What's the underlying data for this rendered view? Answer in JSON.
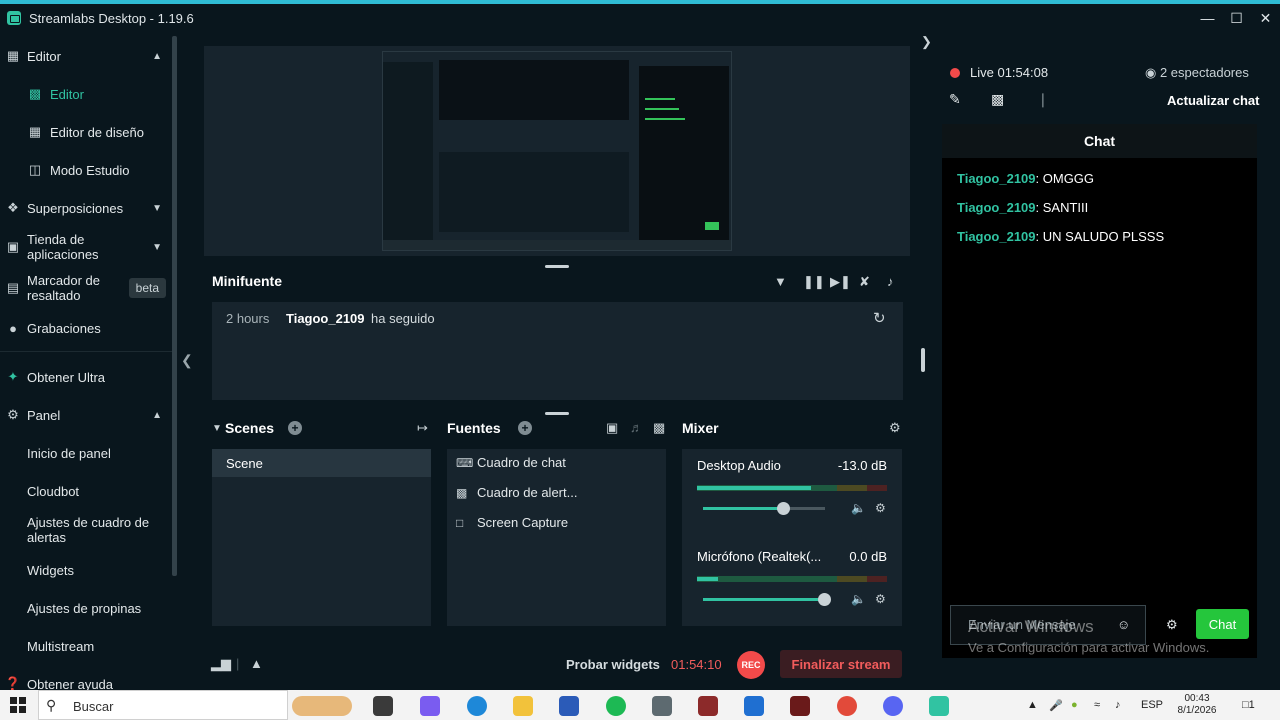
{
  "window": {
    "title": "Streamlabs Desktop - 1.19.6"
  },
  "sidebar": {
    "editor_group": "Editor",
    "editor": "Editor",
    "layout_editor": "Editor de diseño",
    "studio_mode": "Modo Estudio",
    "overlays": "Superposiciones",
    "app_store": "Tienda de aplicaciones",
    "highlighter": "Marcador de resaltado",
    "beta": "beta",
    "recordings": "Grabaciones",
    "ultra": "Obtener Ultra",
    "panel": "Panel",
    "dashboard_home": "Inicio de panel",
    "cloudbot": "Cloudbot",
    "alert_box_settings": "Ajustes de cuadro de alertas",
    "widgets": "Widgets",
    "tip_settings": "Ajustes de propinas",
    "multistream": "Multistream",
    "help": "Obtener ayuda"
  },
  "minifeed": {
    "title": "Minifuente",
    "events": [
      {
        "time": "2 hours",
        "user": "Tiagoo_2109",
        "action": "ha seguido"
      }
    ]
  },
  "scenes": {
    "title": "Scenes",
    "items": [
      "Scene"
    ]
  },
  "sources": {
    "title": "Fuentes",
    "items": [
      "Cuadro de chat",
      "Cuadro de alert...",
      "Screen Capture"
    ]
  },
  "mixer": {
    "title": "Mixer",
    "channels": [
      {
        "name": "Desktop Audio",
        "db": "-13.0 dB",
        "volume": 0.66,
        "level": 0.6
      },
      {
        "name": "Micrófono (Realtek(...",
        "db": "0.0 dB",
        "volume": 1.0,
        "level": 0.11
      }
    ]
  },
  "footer": {
    "test_widgets": "Probar widgets",
    "timer": "01:54:10",
    "rec": "REC",
    "end_stream": "Finalizar stream"
  },
  "live": {
    "status": "Live",
    "time": "01:54:08",
    "viewers": "2 espectadores",
    "refresh_chat": "Actualizar chat"
  },
  "chat": {
    "title": "Chat",
    "messages": [
      {
        "user": "Tiagoo_2109",
        "text": ": OMGGG"
      },
      {
        "user": "Tiagoo_2109",
        "text": ": SANTIII"
      },
      {
        "user": "Tiagoo_2109",
        "text": ": UN SALUDO PLSSS"
      }
    ],
    "input_placeholder": "Enviar un Mensaje",
    "send": "Chat"
  },
  "watermark": {
    "line1": "Activar Windows",
    "line2": "Ve a Configuración para activar Windows."
  },
  "taskbar": {
    "search": "Buscar",
    "lang": "ESP",
    "time": "00:43",
    "date": "8/1/2026",
    "notif": "1"
  },
  "colors": {
    "accent": "#31c3a2",
    "live_red": "#f24a4a",
    "chat_green": "#25c63c"
  }
}
